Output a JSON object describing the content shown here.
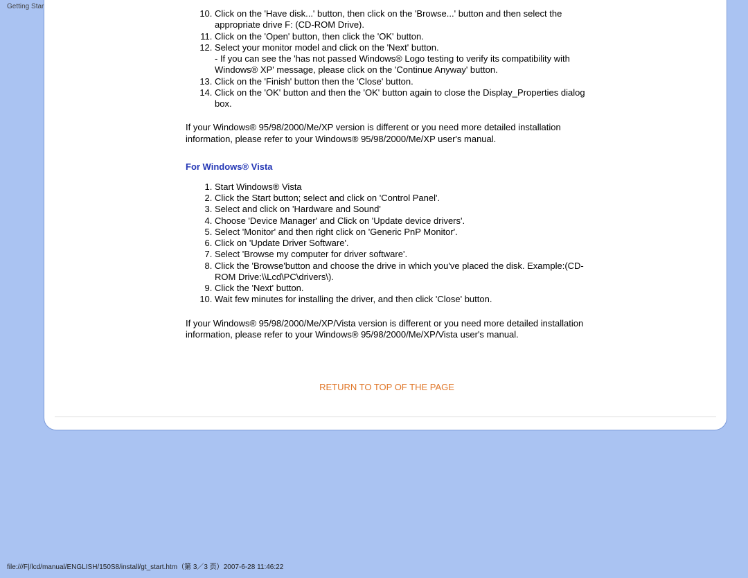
{
  "topbar": {
    "title": "Getting Started"
  },
  "xp_list": {
    "start_num": 10,
    "items": [
      {
        "text": "Click on the 'Have disk...' button, then click on the 'Browse...' button and then select the appropriate drive F: (CD-ROM Drive)."
      },
      {
        "text": "Click on the 'Open' button, then click the 'OK' button."
      },
      {
        "text": "Select your monitor model and click on the 'Next' button.",
        "sub": "- If you can see the 'has not passed Windows® Logo testing to verify its compatibility with Windows® XP' message, please click on the 'Continue Anyway' button."
      },
      {
        "text": "Click on the 'Finish' button then the 'Close' button."
      },
      {
        "text": "Click on the 'OK' button and then the 'OK' button again to close the Display_Properties dialog box."
      }
    ]
  },
  "xp_note": "If your Windows® 95/98/2000/Me/XP version is different or you need more detailed installation information, please refer to your Windows® 95/98/2000/Me/XP user's manual.",
  "vista_heading": "For Windows® Vista",
  "vista_list": {
    "start_num": 1,
    "items": [
      {
        "text": "Start Windows® Vista"
      },
      {
        "text": "Click the Start button; select and click on 'Control Panel'."
      },
      {
        "text": "Select and click on 'Hardware and Sound'"
      },
      {
        "text": "Choose 'Device Manager' and Click on 'Update device drivers'."
      },
      {
        "text": "Select 'Monitor' and then right click on 'Generic PnP Monitor'."
      },
      {
        "text": "Click on 'Update Driver Software'."
      },
      {
        "text": "Select 'Browse my computer for driver software'."
      },
      {
        "text": "Click the 'Browse'button and choose the drive in which you've placed the disk. Example:(CD-ROM Drive:\\\\Lcd\\PC\\drivers\\)."
      },
      {
        "text": "Click the 'Next' button."
      },
      {
        "text": "Wait few minutes for installing the driver, and then click 'Close' button."
      }
    ]
  },
  "vista_note": "If your Windows® 95/98/2000/Me/XP/Vista version is different or you need more detailed installation information, please refer to your Windows® 95/98/2000/Me/XP/Vista user's manual.",
  "return_label": "RETURN TO TOP OF THE PAGE",
  "footer": "file:///F|/lcd/manual/ENGLISH/150S8/install/gt_start.htm（第 3／3 页）2007-6-28 11:46:22"
}
